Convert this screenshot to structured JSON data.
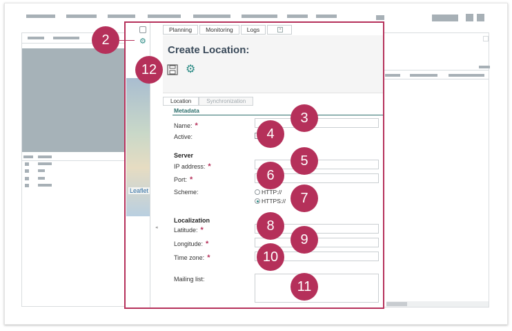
{
  "tabs": {
    "planning": "Planning",
    "monitoring": "Monitoring",
    "logs": "Logs"
  },
  "page_title": "Create Location:",
  "sub_tabs": {
    "location": "Location",
    "synchronization": "Synchronization"
  },
  "sections": {
    "metadata": "Metadata",
    "server": "Server",
    "localization": "Localization"
  },
  "fields": {
    "name": "Name:",
    "active": "Active:",
    "ip_address": "IP address:",
    "port": "Port:",
    "scheme": "Scheme:",
    "latitude": "Latitude:",
    "longitude": "Longitude:",
    "time_zone": "Time zone:",
    "mailing_list": "Mailing list:"
  },
  "required_mark": "*",
  "scheme_options": {
    "http": "HTTP://",
    "https": "HTTPS://",
    "selected": "HTTPS://"
  },
  "map_label": "Leaflet",
  "callouts": {
    "c2": "2",
    "c3": "3",
    "c4": "4",
    "c5": "5",
    "c6": "6",
    "c7": "7",
    "c8": "8",
    "c9": "9",
    "c10": "10",
    "c11": "11",
    "c12": "12"
  },
  "icons": {
    "save": "save-icon",
    "settings": "gear-icon"
  },
  "colors": {
    "callout": "#b5305a",
    "accent": "#2a6d6a",
    "background_bars": "#a7b0b6"
  }
}
